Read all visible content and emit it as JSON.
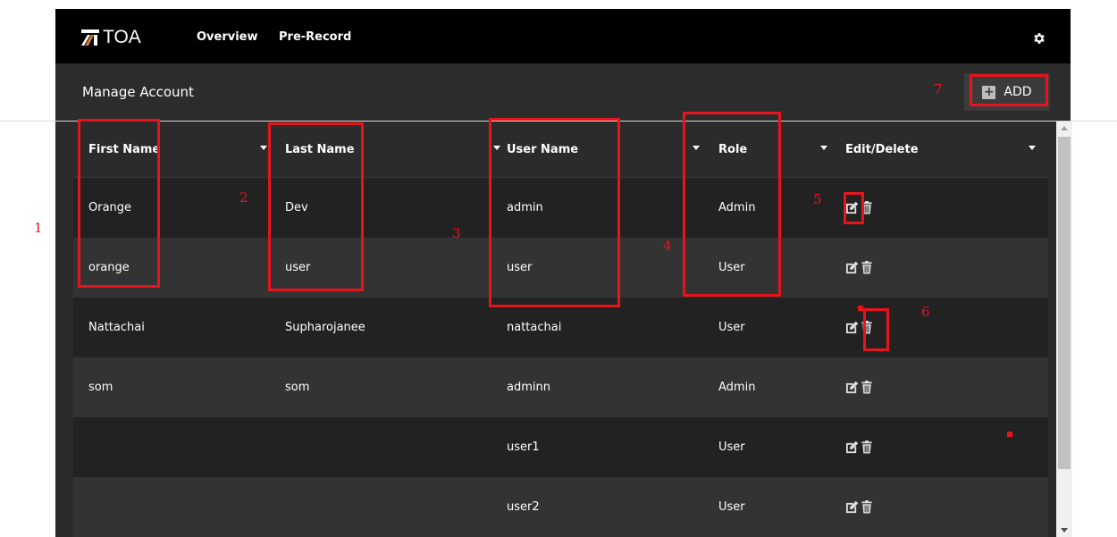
{
  "brand": {
    "logo_text": "TOA"
  },
  "nav": {
    "overview": "Overview",
    "prerecord": "Pre-Record"
  },
  "icons": {
    "settings": "gear-icon",
    "add": "plus-square-icon",
    "edit": "pencil-square-icon",
    "delete": "trash-icon"
  },
  "page": {
    "title": "Manage Account"
  },
  "toolbar": {
    "add_label": "ADD"
  },
  "table": {
    "columns": [
      "First Name",
      "Last Name",
      "User Name",
      "Role",
      "Edit/Delete"
    ],
    "rows": [
      {
        "first": "Orange",
        "last": "Dev",
        "username": "admin",
        "role": "Admin"
      },
      {
        "first": "orange",
        "last": "user",
        "username": "user",
        "role": "User"
      },
      {
        "first": "Nattachai",
        "last": "Supharojanee",
        "username": "nattachai",
        "role": "User"
      },
      {
        "first": "som",
        "last": "som",
        "username": "adminn",
        "role": "Admin"
      },
      {
        "first": "",
        "last": "",
        "username": "user1",
        "role": "User"
      },
      {
        "first": "",
        "last": "",
        "username": "user2",
        "role": "User"
      }
    ]
  },
  "annotations": [
    "1",
    "2",
    "3",
    "4",
    "5",
    "6",
    "7"
  ],
  "colors": {
    "annotation": "#e8141c",
    "topbar": "#000000",
    "row_dark": "#222222",
    "row_light": "#333333"
  }
}
